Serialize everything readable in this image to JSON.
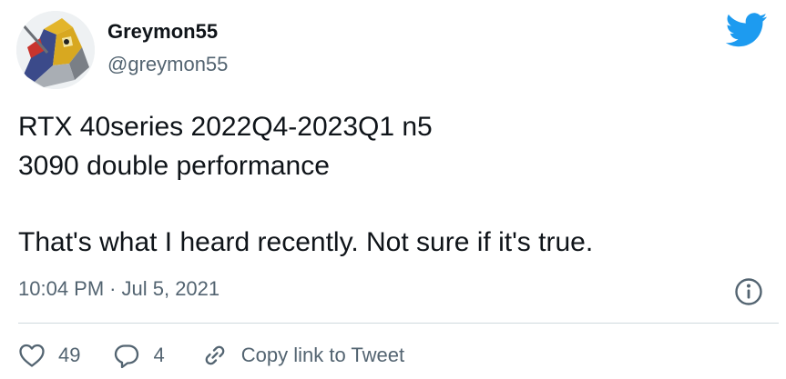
{
  "author": {
    "display_name": "Greymon55",
    "handle": "@greymon55",
    "avatar_icon": "avatar-robot-image"
  },
  "brand": {
    "icon": "twitter-bird-icon",
    "color": "#1d9bf0"
  },
  "tweet": {
    "lines": [
      "RTX 40series 2022Q4-2023Q1 n5",
      "3090 double performance",
      "That's what I heard recently. Not sure if it's true."
    ],
    "time": "10:04 PM",
    "separator": "·",
    "date": "Jul 5, 2021"
  },
  "actions": {
    "like_count": "49",
    "reply_count": "4",
    "copy_link_label": "Copy link to Tweet"
  },
  "colors": {
    "text_primary": "#0f1419",
    "text_secondary": "#536471",
    "divider": "#cfd9de"
  }
}
